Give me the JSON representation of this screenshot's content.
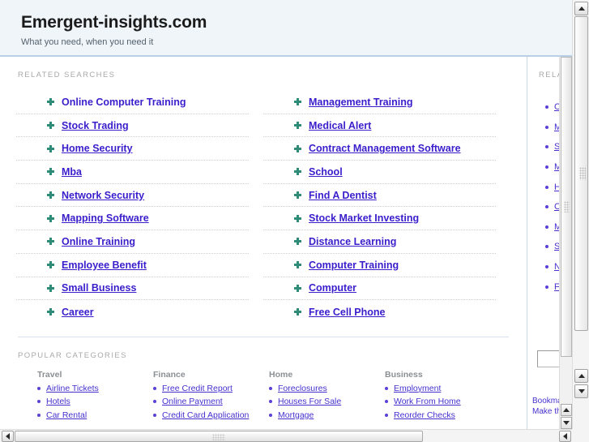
{
  "header": {
    "title": "Emergent-insights.com",
    "tagline": "What you need, when you need it",
    "background_color": "#eff5f9",
    "border_color": "#b9cfe3"
  },
  "main": {
    "related_searches_label": "RELATED SEARCHES",
    "popular_categories_label": "POPULAR CATEGORIES",
    "link_color": "#3a1ecc",
    "bullet_color": "#2e8b77",
    "related_searches": {
      "left_column": [
        {
          "label": "Online Computer Training",
          "underlined": false,
          "icon": "star-bullet-icon"
        },
        {
          "label": "Stock Trading",
          "underlined": true,
          "icon": "star-bullet-icon"
        },
        {
          "label": "Home Security",
          "underlined": true,
          "icon": "star-bullet-icon"
        },
        {
          "label": "Mba",
          "underlined": true,
          "icon": "star-bullet-icon"
        },
        {
          "label": "Network Security",
          "underlined": true,
          "icon": "star-bullet-icon"
        },
        {
          "label": "Mapping Software",
          "underlined": true,
          "icon": "star-bullet-icon"
        },
        {
          "label": "Online Training",
          "underlined": true,
          "icon": "star-bullet-icon"
        },
        {
          "label": "Employee Benefit",
          "underlined": true,
          "icon": "star-bullet-icon"
        },
        {
          "label": "Small Business",
          "underlined": true,
          "icon": "star-bullet-icon"
        },
        {
          "label": "Career",
          "underlined": true,
          "icon": "star-bullet-icon"
        }
      ],
      "right_column": [
        {
          "label": "Management Training",
          "underlined": true,
          "icon": "star-bullet-icon"
        },
        {
          "label": "Medical Alert",
          "underlined": true,
          "icon": "star-bullet-icon"
        },
        {
          "label": "Contract Management Software",
          "underlined": true,
          "icon": "star-bullet-icon"
        },
        {
          "label": "School",
          "underlined": true,
          "icon": "star-bullet-icon"
        },
        {
          "label": "Find A Dentist",
          "underlined": true,
          "icon": "star-bullet-icon"
        },
        {
          "label": "Stock Market Investing",
          "underlined": true,
          "icon": "star-bullet-icon"
        },
        {
          "label": "Distance Learning",
          "underlined": true,
          "icon": "star-bullet-icon"
        },
        {
          "label": "Computer Training",
          "underlined": true,
          "icon": "star-bullet-icon"
        },
        {
          "label": "Computer",
          "underlined": true,
          "icon": "star-bullet-icon"
        },
        {
          "label": "Free Cell Phone",
          "underlined": true,
          "icon": "star-bullet-icon"
        }
      ]
    },
    "categories": [
      {
        "title": "Travel",
        "items": [
          "Airline Tickets",
          "Hotels",
          "Car Rental"
        ]
      },
      {
        "title": "Finance",
        "items": [
          "Free Credit Report",
          "Online Payment",
          "Credit Card Application"
        ]
      },
      {
        "title": "Home",
        "items": [
          "Foreclosures",
          "Houses For Sale",
          "Mortgage"
        ]
      },
      {
        "title": "Business",
        "items": [
          "Employment",
          "Work From Home",
          "Reorder Checks"
        ]
      }
    ]
  },
  "sidebar": {
    "label": "RELATED",
    "items": [
      {
        "label": "Online Computer Training",
        "icon": "dot-bullet-icon"
      },
      {
        "label": "Management Training",
        "icon": "dot-bullet-icon"
      },
      {
        "label": "Stock Trading",
        "icon": "dot-bullet-icon"
      },
      {
        "label": "Medical Alert",
        "icon": "dot-bullet-icon"
      },
      {
        "label": "Home Security",
        "icon": "dot-bullet-icon"
      },
      {
        "label": "Contract Management Software",
        "icon": "dot-bullet-icon"
      },
      {
        "label": "Mba",
        "icon": "dot-bullet-icon"
      },
      {
        "label": "School",
        "icon": "dot-bullet-icon"
      },
      {
        "label": "Network Security",
        "icon": "dot-bullet-icon"
      },
      {
        "label": "Find A Dentist",
        "icon": "dot-bullet-icon"
      }
    ],
    "search": {
      "value": "",
      "placeholder": ""
    },
    "footer_links": [
      "Bookmark this page",
      "Make this my homepage"
    ]
  },
  "scrollbars": {
    "inner_vertical": {
      "icon_up": "triangle-up-icon",
      "icon_down": "triangle-down-icon"
    },
    "outer_vertical": {
      "icon_up": "triangle-up-icon",
      "icon_down": "triangle-down-icon"
    },
    "outer_horizontal": {
      "icon_left": "triangle-left-icon",
      "icon_right": "triangle-right-icon"
    }
  }
}
